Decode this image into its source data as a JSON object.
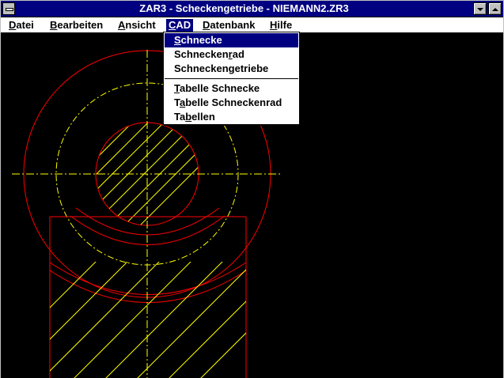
{
  "window": {
    "title": "ZAR3 - Scheckengetriebe  -  NIEMANN2.ZR3"
  },
  "menubar": {
    "items": [
      {
        "accel": "D",
        "rest": "atei"
      },
      {
        "accel": "B",
        "rest": "earbeiten"
      },
      {
        "accel": "A",
        "rest": "nsicht"
      },
      {
        "accel": "C",
        "rest": "AD"
      },
      {
        "pre": "",
        "accel": "D",
        "rest": "atenbank"
      },
      {
        "accel": "H",
        "rest": "ilfe"
      }
    ]
  },
  "cad_menu": {
    "group1": [
      {
        "pre": "",
        "accel": "S",
        "post": "chnecke"
      },
      {
        "pre": "Schnecken",
        "accel": "r",
        "post": "ad"
      },
      {
        "pre": "Schnecken",
        "accel": "g",
        "post": "etriebe"
      }
    ],
    "group2": [
      {
        "pre": "",
        "accel": "T",
        "post": "abelle Schnecke"
      },
      {
        "pre": "T",
        "accel": "a",
        "post": "belle Schneckenrad"
      },
      {
        "pre": "Ta",
        "accel": "b",
        "post": "ellen"
      }
    ]
  },
  "colors": {
    "outline": "#ff0000",
    "hatch_centerline": "#ffff00",
    "highlight": "#000080",
    "background": "#000000"
  }
}
